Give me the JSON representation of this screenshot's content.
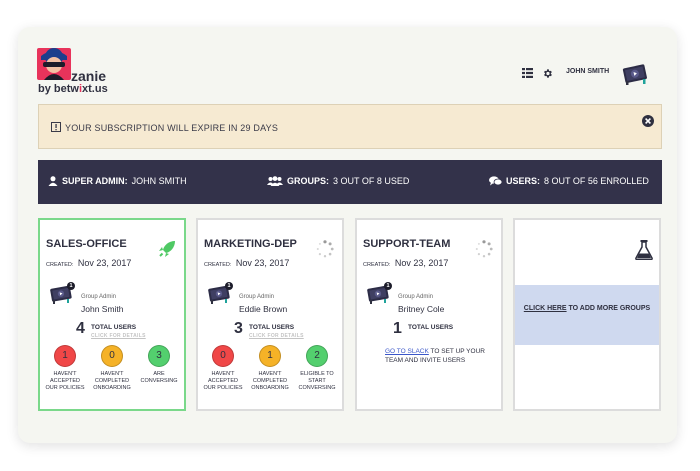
{
  "brand": {
    "name": "zanie",
    "by_prefix": "by ",
    "by_company_a": "betw",
    "by_company_accent": "i",
    "by_company_b": "xt.us",
    "colors": {
      "tile": "#e8335b",
      "accent": "#e8335b",
      "dark": "#2f3040"
    }
  },
  "header": {
    "user_name": "JOHN SMITH",
    "icons": [
      "list-icon",
      "gear-icon",
      "user-avatar"
    ]
  },
  "alert": {
    "text": "YOUR SUBSCRIPTION WILL EXPIRE IN 29 DAYS",
    "icons": [
      "warning-icon",
      "close-icon"
    ]
  },
  "stats": {
    "admin": {
      "label": "SUPER ADMIN:",
      "value": "JOHN SMITH"
    },
    "groups": {
      "label": "GROUPS:",
      "value": "3 OUT OF 8 USED"
    },
    "users": {
      "label": "USERS:",
      "value": "8 OUT OF 56 ENROLLED"
    }
  },
  "cards": [
    {
      "title": "SALES-OFFICE",
      "created_label": "CREATED:",
      "created_date": "Nov 23, 2017",
      "admin_count": "1",
      "admin_label": "Group Admin",
      "admin_name": "John Smith",
      "total": "4",
      "total_label": "TOTAL USERS",
      "details_link": "CLICK FOR DETAILS",
      "metrics": [
        {
          "value": "1",
          "label": "HAVEN'T ACCEPTED OUR POLICIES",
          "color": "#f04747"
        },
        {
          "value": "0",
          "label": "HAVEN'T COMPLETED ONBOARDING",
          "color": "#f5b227"
        },
        {
          "value": "3",
          "label": "ARE CONVERSING",
          "color": "#53cf6e"
        }
      ]
    },
    {
      "title": "MARKETING-DEP",
      "created_label": "CREATED:",
      "created_date": "Nov 23, 2017",
      "admin_count": "1",
      "admin_label": "Group Admin",
      "admin_name": "Eddie Brown",
      "total": "3",
      "total_label": "TOTAL USERS",
      "details_link": "CLICK FOR DETAILS",
      "metrics": [
        {
          "value": "0",
          "label": "HAVEN'T ACCEPTED OUR POLICIES",
          "color": "#f04747"
        },
        {
          "value": "1",
          "label": "HAVEN'T COMPLETED ONBOARDING",
          "color": "#f5b227"
        },
        {
          "value": "2",
          "label": "ELIGIBLE TO START CONVERSING",
          "color": "#53cf6e"
        }
      ]
    },
    {
      "title": "SUPPORT-TEAM",
      "created_label": "CREATED:",
      "created_date": "Nov 23, 2017",
      "admin_count": "1",
      "admin_label": "Group Admin",
      "admin_name": "Britney Cole",
      "total": "1",
      "total_label": "TOTAL USERS",
      "slack_link": "GO TO SLACK",
      "slack_rest": " TO SET UP YOUR TEAM AND INVITE USERS"
    },
    {
      "add_link": "CLICK HERE",
      "add_rest": " TO ADD MORE GROUPS"
    }
  ]
}
